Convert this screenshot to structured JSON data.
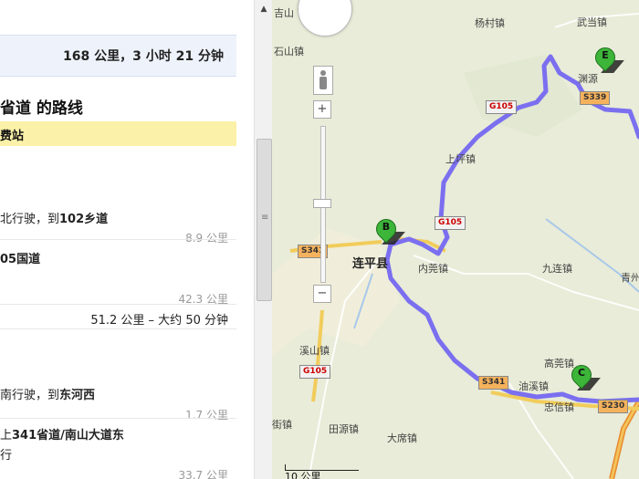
{
  "summary": "168 公里，3 小时 21 分钟",
  "route_title": "省道 的路线",
  "toll_notice": "费站",
  "steps": [
    {
      "pre": "北行驶，到",
      "road": "102乡道",
      "dist": "8.9 公里"
    },
    {
      "pre": "",
      "road": "05国道",
      "dist": "42.3 公里"
    },
    {
      "pre": "南行驶，到",
      "road": "东河西",
      "dist": "1.7 公里"
    },
    {
      "pre": "上",
      "road": "341省道/南山大道东",
      "line2": "行",
      "dist": "33.7 公里"
    }
  ],
  "segment": "51.2 公里 – 大约 50 分钟",
  "map": {
    "towns": {
      "jishan": "吉山",
      "shishan": "石山镇",
      "yangcun": "杨村镇",
      "wudang": "武当镇",
      "liyuan": "渊源",
      "shangping": "上坪镇",
      "neiguan": "内莞镇",
      "jiulian": "九连镇",
      "qing": "青州",
      "xishan": "溪山镇",
      "gaoguan": "高莞镇",
      "youxi": "油溪镇",
      "zhongxin": "忠信镇",
      "jie": "街镇",
      "tianyuan": "田源镇",
      "daxi": "大席镇"
    },
    "city": "连平县",
    "shields": {
      "g105a": "G105",
      "g105b": "G105",
      "g105c": "G105",
      "s341a": "S341",
      "s341b": "S341",
      "s339": "S339",
      "s230": "S230"
    },
    "markers": {
      "b": "B",
      "c": "C",
      "e": "E"
    },
    "scale": "10 公里",
    "zoom_plus": "+",
    "zoom_minus": "−",
    "route_color": "#7b6ff0"
  },
  "scroll_arrow": "▲",
  "scroll_grip": "≡"
}
